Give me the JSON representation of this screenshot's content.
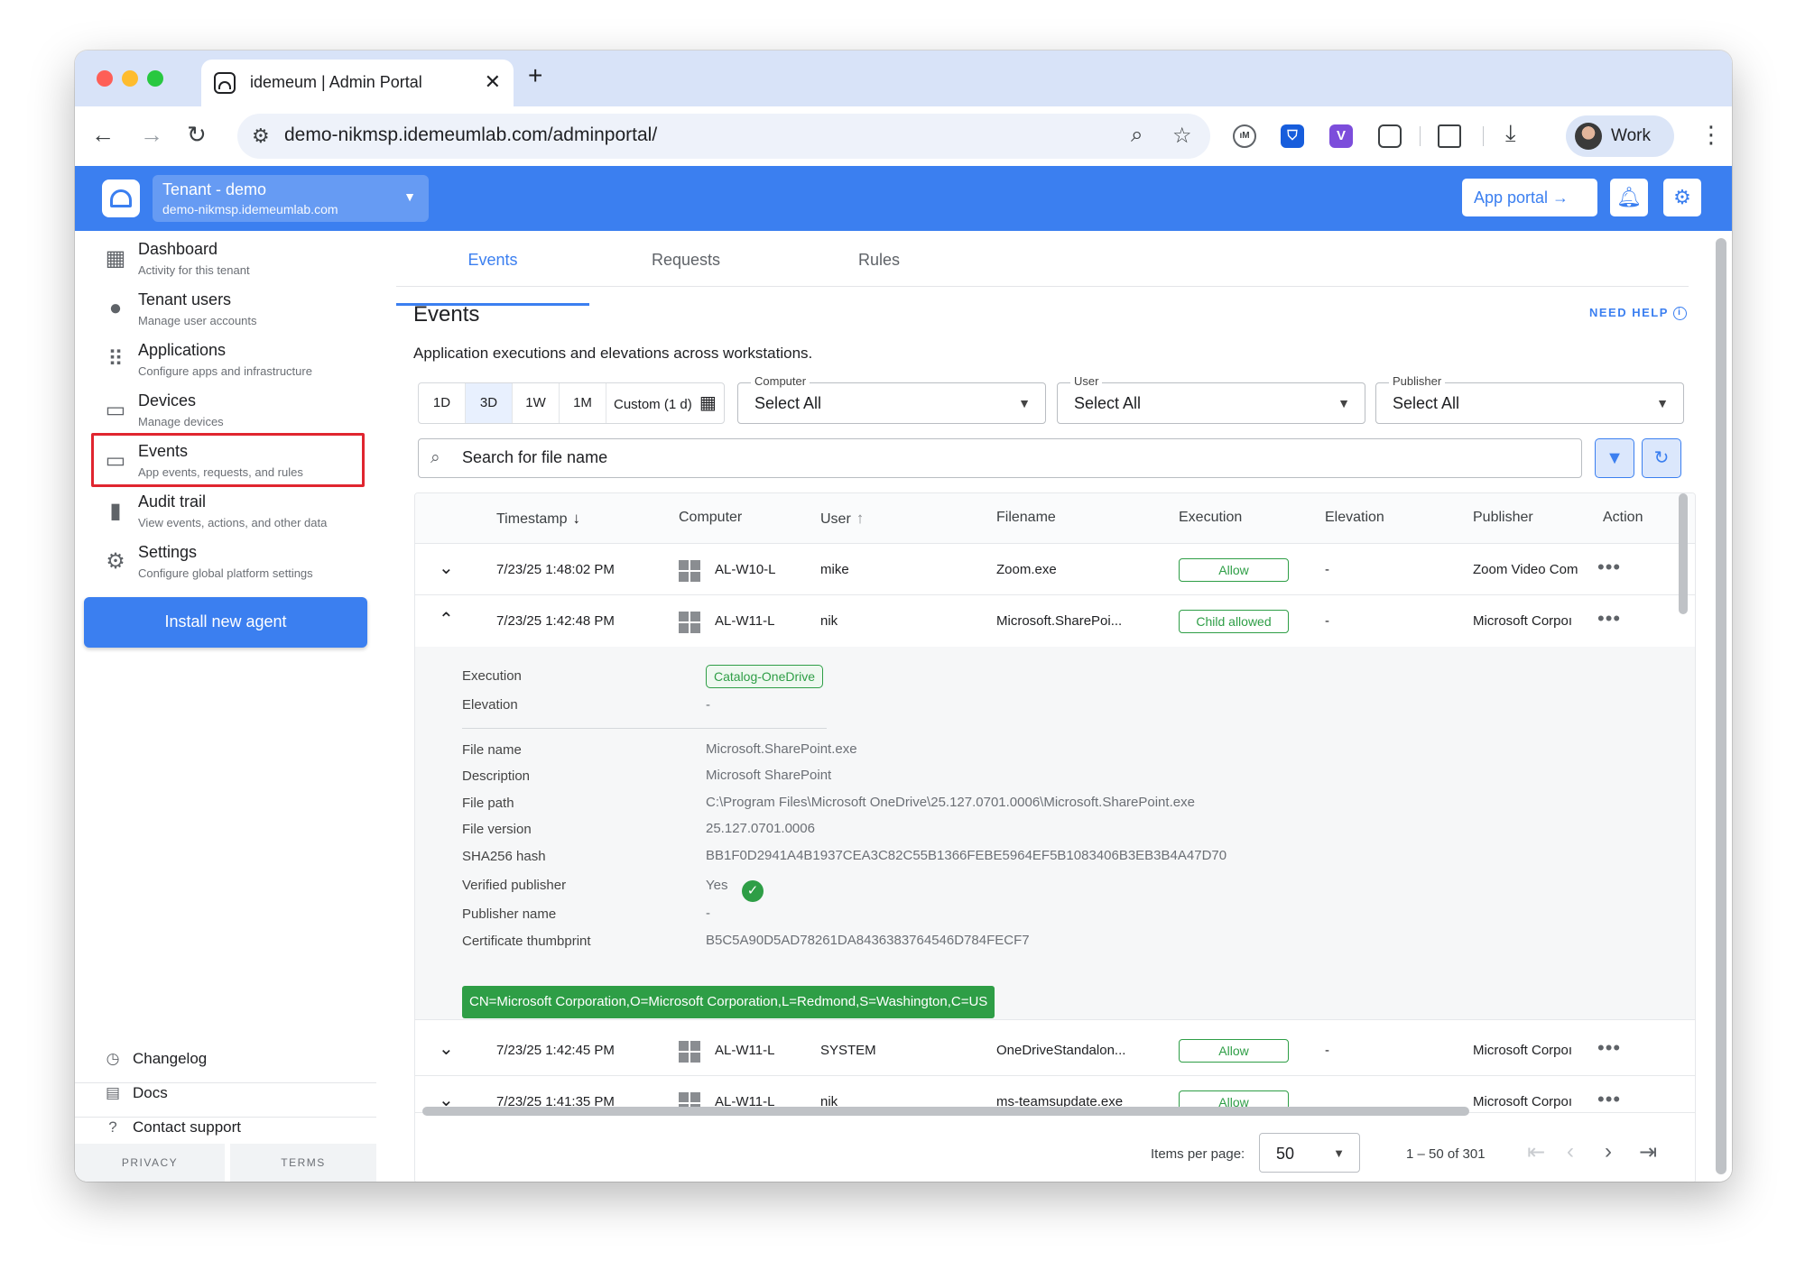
{
  "browser": {
    "tab_title": "idemeum | Admin Portal",
    "tab_close": "✕",
    "new_tab": "+",
    "url": "demo-nikmsp.idemeumlab.com/adminportal/",
    "profile_label": "Work",
    "ext_icons": [
      "idm-extension-icon",
      "bitwarden-icon",
      "v-extension-icon",
      "puzzle-icon",
      "tab-search-icon",
      "download-icon"
    ]
  },
  "header": {
    "tenant_name": "Tenant - demo",
    "tenant_domain": "demo-nikmsp.idemeumlab.com",
    "app_portal_label": "App portal →",
    "accent_color": "#3b7ff0"
  },
  "sidebar": {
    "items": [
      {
        "label": "Dashboard",
        "sub": "Activity for this tenant",
        "icon": "dashboard-icon"
      },
      {
        "label": "Tenant users",
        "sub": "Manage user accounts",
        "icon": "person-icon"
      },
      {
        "label": "Applications",
        "sub": "Configure apps and infrastructure",
        "icon": "apps-grid-icon"
      },
      {
        "label": "Devices",
        "sub": "Manage devices",
        "icon": "monitor-icon"
      },
      {
        "label": "Events",
        "sub": "App events, requests, and rules",
        "icon": "devices-icon"
      },
      {
        "label": "Audit trail",
        "sub": "View events, actions, and other data",
        "icon": "bar-chart-icon"
      },
      {
        "label": "Settings",
        "sub": "Configure global platform settings",
        "icon": "gear-icon"
      }
    ],
    "active": "Events",
    "install_label": "Install new agent",
    "footer": {
      "changelog": "Changelog",
      "docs": "Docs",
      "support": "Contact support",
      "privacy": "PRIVACY",
      "terms": "TERMS"
    }
  },
  "main": {
    "tabs": [
      "Events",
      "Requests",
      "Rules"
    ],
    "active_tab": "Events",
    "title": "Events",
    "need_help": "NEED HELP",
    "description": "Application executions and elevations across workstations.",
    "ranges": [
      "1D",
      "3D",
      "1W",
      "1M",
      "Custom (1 d)"
    ],
    "selected_range": "3D",
    "filters": {
      "computer": {
        "label": "Computer",
        "value": "Select All"
      },
      "user": {
        "label": "User",
        "value": "Select All"
      },
      "publisher": {
        "label": "Publisher",
        "value": "Select All"
      }
    },
    "search_placeholder": "Search for file name",
    "columns": {
      "timestamp": "Timestamp",
      "computer": "Computer",
      "user": "User",
      "filename": "Filename",
      "execution": "Execution",
      "elevation": "Elevation",
      "publisher": "Publisher",
      "action": "Action"
    },
    "rows": [
      {
        "timestamp": "7/23/25 1:48:02 PM",
        "computer": "AL-W10-L",
        "user": "mike",
        "filename": "Zoom.exe",
        "execution": "Allow",
        "elevation": "-",
        "publisher": "Zoom Video Com",
        "expanded": false
      },
      {
        "timestamp": "7/23/25 1:42:48 PM",
        "computer": "AL-W11-L",
        "user": "nik",
        "filename": "Microsoft.SharePoi...",
        "execution": "Child allowed",
        "elevation": "-",
        "publisher": "Microsoft Corpoı",
        "expanded": true
      },
      {
        "timestamp": "7/23/25 1:42:45 PM",
        "computer": "AL-W11-L",
        "user": "SYSTEM",
        "filename": "OneDriveStandalon...",
        "execution": "Allow",
        "elevation": "-",
        "publisher": "Microsoft Corpoı",
        "expanded": false
      },
      {
        "timestamp": "7/23/25 1:41:35 PM",
        "computer": "AL-W11-L",
        "user": "nik",
        "filename": "ms-teamsupdate.exe",
        "execution": "Allow",
        "elevation": "",
        "publisher": "Microsoft Corpoı",
        "expanded": false
      }
    ],
    "detail": {
      "execution_label": "Execution",
      "execution_value": "Catalog-OneDrive",
      "elevation_label": "Elevation",
      "elevation_value": "-",
      "file_name_label": "File name",
      "file_name": "Microsoft.SharePoint.exe",
      "description_label": "Description",
      "description": "Microsoft SharePoint",
      "file_path_label": "File path",
      "file_path": "C:\\Program Files\\Microsoft OneDrive\\25.127.0701.0006\\Microsoft.SharePoint.exe",
      "file_version_label": "File version",
      "file_version": "25.127.0701.0006",
      "sha_label": "SHA256 hash",
      "sha": "BB1F0D2941A4B1937CEA3C82C55B1366FEBE5964EF5B1083406B3EB3B4A47D70",
      "verified_label": "Verified publisher",
      "verified": "Yes",
      "publisher_name_label": "Publisher name",
      "publisher_name": "-",
      "thumbprint_label": "Certificate thumbprint",
      "thumbprint": "B5C5A90D5AD78261DA8436383764546D784FECF7",
      "subject": "CN=Microsoft Corporation,O=Microsoft Corporation,L=Redmond,S=Washington,C=US"
    },
    "pager": {
      "label": "Items per page:",
      "page_size": "50",
      "range": "1 – 50 of 301"
    }
  }
}
